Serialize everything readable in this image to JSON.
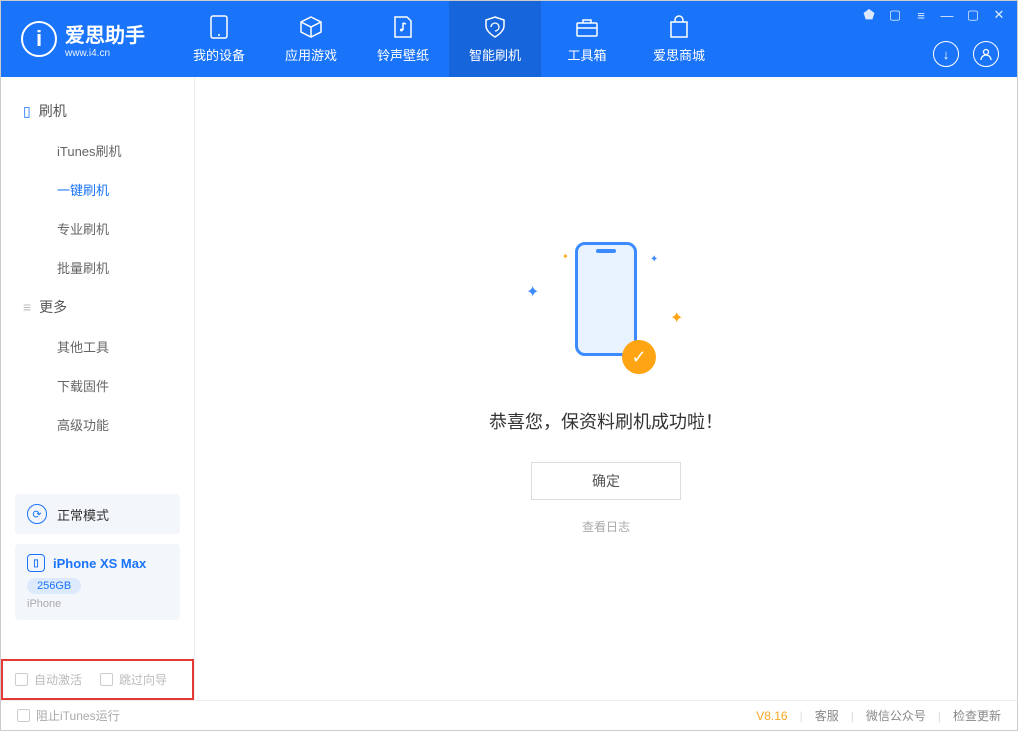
{
  "app": {
    "name": "爱思助手",
    "url": "www.i4.cn"
  },
  "nav": {
    "items": [
      {
        "label": "我的设备"
      },
      {
        "label": "应用游戏"
      },
      {
        "label": "铃声壁纸"
      },
      {
        "label": "智能刷机"
      },
      {
        "label": "工具箱"
      },
      {
        "label": "爱思商城"
      }
    ]
  },
  "sidebar": {
    "section1": {
      "title": "刷机"
    },
    "items1": [
      {
        "label": "iTunes刷机"
      },
      {
        "label": "一键刷机"
      },
      {
        "label": "专业刷机"
      },
      {
        "label": "批量刷机"
      }
    ],
    "section2": {
      "title": "更多"
    },
    "items2": [
      {
        "label": "其他工具"
      },
      {
        "label": "下载固件"
      },
      {
        "label": "高级功能"
      }
    ],
    "mode": "正常模式",
    "device": {
      "name": "iPhone XS Max",
      "storage": "256GB",
      "type": "iPhone"
    },
    "opts": {
      "auto_activate": "自动激活",
      "skip_guide": "跳过向导"
    }
  },
  "main": {
    "message": "恭喜您，保资料刷机成功啦！",
    "ok": "确定",
    "view_log": "查看日志"
  },
  "footer": {
    "block_itunes": "阻止iTunes运行",
    "version": "V8.16",
    "support": "客服",
    "wechat": "微信公众号",
    "update": "检查更新"
  }
}
